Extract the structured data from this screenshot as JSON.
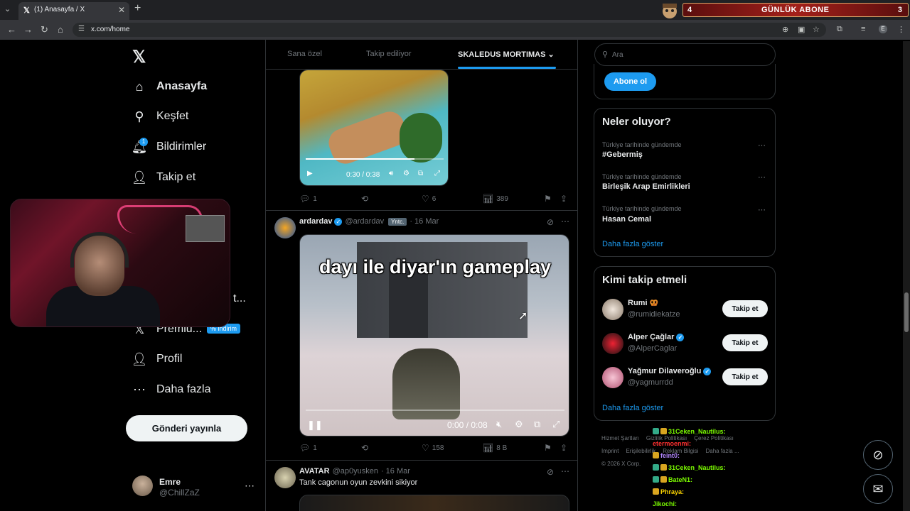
{
  "browser": {
    "tab_title": "(1) Anasayfa / X",
    "url": "x.com/home",
    "profile_initial": "E"
  },
  "stream_banner": {
    "left_count": "4",
    "label": "GÜNLÜK ABONE",
    "right_count": "3"
  },
  "nav": {
    "items": [
      {
        "label": "Anasayfa",
        "icon": "home-icon"
      },
      {
        "label": "Keşfet",
        "icon": "search-icon"
      },
      {
        "label": "Bildirimler",
        "icon": "bell-icon",
        "badge": "1"
      },
      {
        "label": "Takip et",
        "icon": "follow-icon"
      },
      {
        "label": "t...",
        "icon": "list-icon"
      },
      {
        "label": "Premiu...",
        "icon": "x-premium-icon",
        "badge": "% indirim"
      },
      {
        "label": "Profil",
        "icon": "profile-icon"
      },
      {
        "label": "Daha fazla",
        "icon": "more-circle-icon"
      }
    ],
    "post_button": "Gönderi yayınla",
    "account": {
      "name": "Emre",
      "handle": "@ChillZaZ"
    }
  },
  "feed": {
    "tabs": [
      "Sana özel",
      "Takip ediliyor",
      "SKALEDUS MORTIMAS"
    ],
    "active_tab": 2,
    "post1": {
      "video_time": "0:30 / 0:38",
      "progress": 0.79,
      "replies": "1",
      "reposts": "",
      "likes": "6",
      "views": "389"
    },
    "post2": {
      "name": "ardardav",
      "handle": "@ardardav",
      "badge": "Yntc.",
      "date": "· 16 Mar",
      "video_caption": "dayı ile diyar'ın gameplay",
      "video_time": "0:00 / 0:08",
      "progress": 0.0,
      "replies": "1",
      "reposts": "",
      "likes": "158",
      "views": "8 B"
    },
    "post3": {
      "name": "AVATAR",
      "handle": "@ap0yusken",
      "date": "· 16 Mar",
      "text": "Tank cagonun oyun zevkini sikiyor"
    }
  },
  "sidebar": {
    "search_placeholder": "Ara",
    "subscribe_button": "Abone ol",
    "trends_title": "Neler oluyor?",
    "trends": [
      {
        "context": "Türkiye tarihinde gündemde",
        "name": "#Gebermiş"
      },
      {
        "context": "Türkiye tarihinde gündemde",
        "name": "Birleşik Arap Emirlikleri"
      },
      {
        "context": "Türkiye tarihinde gündemde",
        "name": "Hasan Cemal"
      }
    ],
    "show_more": "Daha fazla göster",
    "who_title": "Kimi takip etmeli",
    "who": [
      {
        "name": "Rumi",
        "handle": "@rumidiekatze",
        "verified": false,
        "emoji": "🥨"
      },
      {
        "name": "Alper Çağlar",
        "handle": "@AlperCaglar",
        "verified": true,
        "emoji": ""
      },
      {
        "name": "Yağmur Dilaveroğlu",
        "handle": "@yagmurrdd",
        "verified": true,
        "emoji": ""
      }
    ],
    "follow_label": "Takip et",
    "footer": [
      "Hizmet Şartları",
      "Gizlilik Politikası",
      "Çerez Politikası",
      "Imprint",
      "Erişilebilirlik",
      "Reklam Bilgisi",
      "Daha fazla ...",
      "© 2026 X Corp."
    ]
  },
  "chat": [
    {
      "user": "31Ceken_Nautilus:",
      "color": "#7cfc00"
    },
    {
      "user": "etermoenmi:",
      "color": "#ff3030"
    },
    {
      "user": "feint0:",
      "color": "#b388ff"
    },
    {
      "user": "31Ceken_Nautilus:",
      "color": "#7cfc00"
    },
    {
      "user": "BateN1:",
      "color": "#7cfc00"
    },
    {
      "user": "Phraya:",
      "color": "#ffd700"
    },
    {
      "user": "Jikochi:",
      "color": "#7cfc00"
    }
  ],
  "colors": {
    "accent": "#1d9bf0",
    "background": "#000000",
    "muted": "#71767b"
  }
}
